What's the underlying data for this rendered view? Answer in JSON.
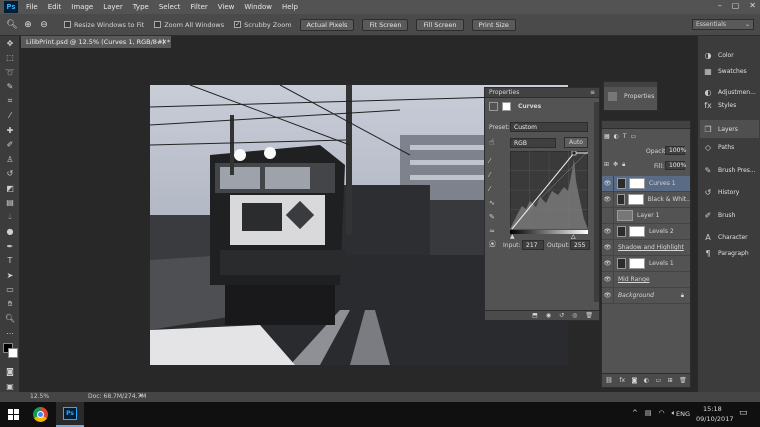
{
  "menu": {
    "logo": "Ps",
    "items": [
      "File",
      "Edit",
      "Image",
      "Layer",
      "Type",
      "Select",
      "Filter",
      "View",
      "Window",
      "Help"
    ]
  },
  "options": {
    "resize_windows": "Resize Windows to Fit",
    "zoom_all": "Zoom All Windows",
    "scrubby": "Scrubby Zoom",
    "actual_pixels": "Actual Pixels",
    "fit_screen": "Fit Screen",
    "fill_screen": "Fill Screen",
    "print_size": "Print Size",
    "workspace": "Essentials"
  },
  "document": {
    "tab_title": "LilibPrint.psd @ 12.5% (Curves 1, RGB/8#) *",
    "zoom": "12.5%",
    "doc_size": "Doc: 68.7M/274.7M"
  },
  "properties": {
    "title": "Properties",
    "adjustment": "Curves",
    "preset_label": "Preset:",
    "preset_value": "Custom",
    "channel": "RGB",
    "auto": "Auto",
    "input_label": "Input:",
    "input_value": "217",
    "output_label": "Output:",
    "output_value": "255"
  },
  "mini_panel": {
    "properties_label": "Properties"
  },
  "layers_panel": {
    "opacity_label": "Opacity:",
    "opacity_value": "100%",
    "fill_label": "Fill:",
    "fill_value": "100%",
    "layers": [
      {
        "name": "Curves 1",
        "selected": true
      },
      {
        "name": "Black & Whit...",
        "selected": false
      },
      {
        "name": "Layer 1",
        "selected": false
      },
      {
        "name": "Levels 2",
        "selected": false
      },
      {
        "name": "Shadow and Highlight",
        "selected": false
      },
      {
        "name": "Levels 1",
        "selected": false
      },
      {
        "name": "Mid Range",
        "selected": false
      },
      {
        "name": "Background",
        "selected": false
      }
    ]
  },
  "dock": {
    "items": [
      "Color",
      "Swatches",
      "Adjustmen...",
      "Styles",
      "Layers",
      "Paths",
      "Brush Pres...",
      "History",
      "Brush",
      "Character",
      "Paragraph"
    ]
  },
  "taskbar": {
    "language": "ENG",
    "time": "15:18",
    "date": "09/10/2017"
  },
  "colors": {
    "accent_selection": "#5a6b85",
    "ps_blue": "#31a8ff"
  }
}
